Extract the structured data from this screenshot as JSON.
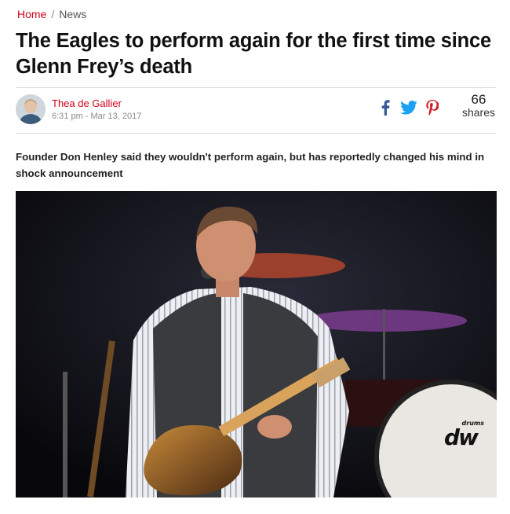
{
  "breadcrumb": {
    "home": "Home",
    "separator": "/",
    "current": "News"
  },
  "article": {
    "headline": "The Eagles to perform again for the first time since Glenn Frey’s death",
    "author": "Thea de Gallier",
    "date": "6:31 pm - Mar 13, 2017",
    "standfirst": "Founder Don Henley said they wouldn't perform again, but has reportedly changed his mind in shock announcement"
  },
  "share": {
    "count": "66",
    "label": "shares",
    "icons": [
      "facebook-icon",
      "twitter-icon",
      "pinterest-icon"
    ]
  },
  "hero_image": {
    "drum_logo_top": "drums",
    "drum_logo": "dw"
  },
  "colors": {
    "accent": "#d0021b",
    "facebook": "#3b5998",
    "twitter": "#1da1f2",
    "pinterest": "#cb2027"
  }
}
